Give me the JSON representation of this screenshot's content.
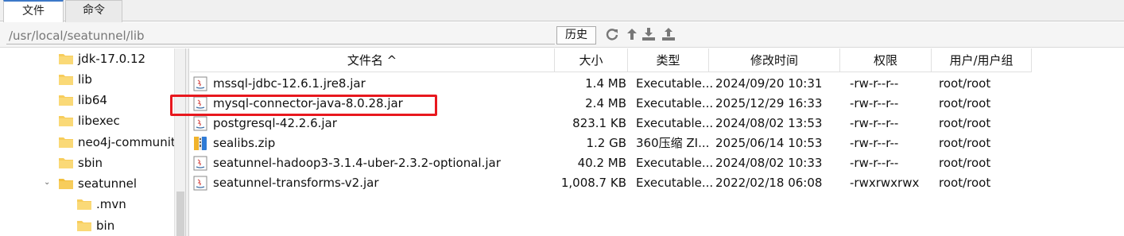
{
  "tabs": [
    {
      "label": "文件",
      "active": true
    },
    {
      "label": "命令",
      "active": false
    }
  ],
  "pathbar": {
    "path": "/usr/local/seatunnel/lib",
    "history_label": "历史"
  },
  "toolbar_icons": [
    "refresh-icon",
    "up-arrow-icon",
    "download-icon",
    "upload-icon"
  ],
  "tree": {
    "items": [
      "jdk-17.0.12",
      "lib",
      "lib64",
      "libexec",
      "neo4j-communit",
      "sbin",
      "seatunnel",
      ".mvn",
      "bin"
    ],
    "expanded": "seatunnel"
  },
  "table": {
    "columns": {
      "name": "文件名 ^",
      "size": "大小",
      "type": "类型",
      "mtime": "修改时间",
      "perm": "权限",
      "owner": "用户/用户组"
    },
    "rows": [
      {
        "name": "mssql-jdbc-12.6.1.jre8.jar",
        "size": "1.4 MB",
        "type": "Executable...",
        "mtime": "2024/09/20 10:31",
        "perm": "-rw-r--r--",
        "owner": "root/root",
        "icon": "java-jar-icon"
      },
      {
        "name": "mysql-connector-java-8.0.28.jar",
        "size": "2.4 MB",
        "type": "Executable...",
        "mtime": "2025/12/29 16:33",
        "perm": "-rw-r--r--",
        "owner": "root/root",
        "icon": "java-jar-icon"
      },
      {
        "name": "postgresql-42.2.6.jar",
        "size": "823.1 KB",
        "type": "Executable...",
        "mtime": "2024/08/02 13:53",
        "perm": "-rw-r--r--",
        "owner": "root/root",
        "icon": "java-jar-icon"
      },
      {
        "name": "sealibs.zip",
        "size": "1.2 GB",
        "type": "360压缩 ZI...",
        "mtime": "2025/06/14 10:53",
        "perm": "-rw-r--r--",
        "owner": "root/root",
        "icon": "zip-archive-icon"
      },
      {
        "name": "seatunnel-hadoop3-3.1.4-uber-2.3.2-optional.jar",
        "size": "40.2 MB",
        "type": "Executable...",
        "mtime": "2024/08/02 10:33",
        "perm": "-rw-r--r--",
        "owner": "root/root",
        "icon": "java-jar-icon"
      },
      {
        "name": "seatunnel-transforms-v2.jar",
        "size": "1,008.7 KB",
        "type": "Executable...",
        "mtime": "2022/02/18 06:08",
        "perm": "-rwxrwxrwx",
        "owner": "root/root",
        "icon": "java-jar-icon"
      }
    ]
  },
  "colors": {
    "highlight": "#e8181e",
    "folder": "#f7cd5c",
    "tab_accent": "#3c78c8"
  }
}
